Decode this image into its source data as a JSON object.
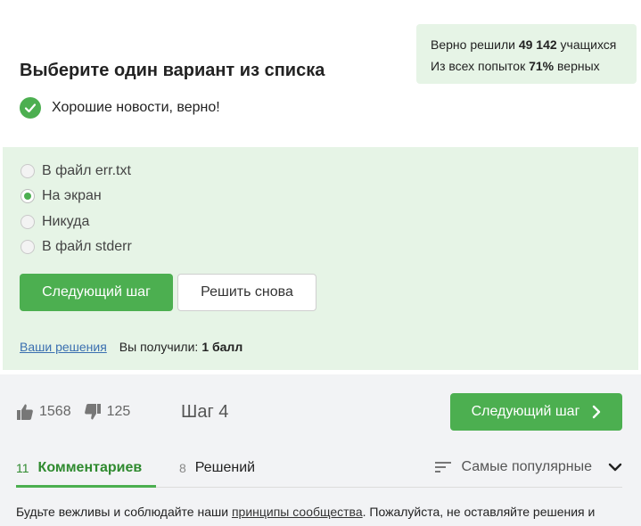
{
  "stats": {
    "solved_prefix": "Верно решили",
    "solved_count": "49 142",
    "solved_suffix": "учащихся",
    "attempts_prefix": "Из всех попыток",
    "attempts_percent": "71%",
    "attempts_suffix": "верных"
  },
  "question": {
    "title": "Выберите один вариант из списка",
    "feedback": "Хорошие новости, верно!"
  },
  "options": [
    {
      "label": "В файл err.txt",
      "checked": false
    },
    {
      "label": "На экран",
      "checked": true
    },
    {
      "label": "Никуда",
      "checked": false
    },
    {
      "label": "В файл stderr",
      "checked": false
    }
  ],
  "actions": {
    "next_step": "Следующий шаг",
    "retry": "Решить снова"
  },
  "result": {
    "my_solutions": "Ваши решения",
    "received_label": "Вы получили:",
    "received_value": "1 балл"
  },
  "footer": {
    "likes": "1568",
    "dislikes": "125",
    "step": "Шаг 4",
    "next_step": "Следующий шаг"
  },
  "tabs": [
    {
      "count": "11",
      "label": "Комментариев",
      "active": true
    },
    {
      "count": "8",
      "label": "Решений",
      "active": false
    }
  ],
  "sort": {
    "label": "Самые популярные"
  },
  "rules": {
    "prefix": "Будьте вежливы и соблюдайте наши",
    "link": "принципы сообщества",
    "suffix": ". Пожалуйста, не оставляйте решения и"
  },
  "colors": {
    "accent": "#4caf50",
    "panel": "#e6f4e6",
    "footer_bg": "#f2f3f5"
  }
}
